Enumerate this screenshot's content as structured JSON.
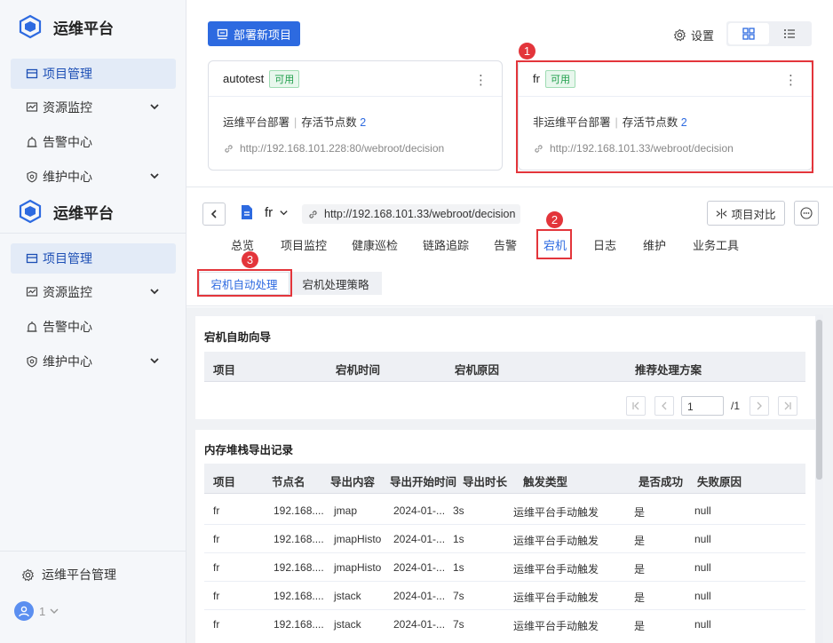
{
  "app": {
    "name": "运维平台"
  },
  "sidebar": {
    "items": [
      {
        "label": "项目管理"
      },
      {
        "label": "资源监控"
      },
      {
        "label": "告警中心"
      },
      {
        "label": "维护中心"
      }
    ],
    "bottom": {
      "label": "运维平台管理",
      "user": "1"
    }
  },
  "toolbar": {
    "deploy_label": "部署新项目",
    "settings_label": "设置"
  },
  "cards": [
    {
      "name": "autotest",
      "status": "可用",
      "type": "运维平台部署",
      "nodes_label": "存活节点数",
      "nodes": "2",
      "url": "http://192.168.101.228:80/webroot/decision"
    },
    {
      "name": "fr",
      "status": "可用",
      "type": "非运维平台部署",
      "nodes_label": "存活节点数",
      "nodes": "2",
      "url": "http://192.168.101.33/webroot/decision"
    }
  ],
  "markers": [
    "1",
    "2",
    "3"
  ],
  "detail": {
    "project": "fr",
    "url": "http://192.168.101.33/webroot/decision",
    "compare_label": "项目对比",
    "tabs": [
      "总览",
      "项目监控",
      "健康巡检",
      "链路追踪",
      "告警",
      "宕机",
      "日志",
      "维护",
      "业务工具"
    ],
    "subtabs": [
      "宕机自动处理",
      "宕机处理策略"
    ]
  },
  "guide": {
    "title": "宕机自助向导",
    "columns": [
      "项目",
      "宕机时间",
      "宕机原因",
      "推荐处理方案"
    ],
    "page": "1",
    "total_pages": "/1"
  },
  "dump": {
    "title": "内存堆栈导出记录",
    "columns": [
      "项目",
      "节点名",
      "导出内容",
      "导出开始时间",
      "导出时长",
      "触发类型",
      "是否成功",
      "失败原因"
    ],
    "rows": [
      [
        "fr",
        "192.168....",
        "jmap",
        "2024-01-...",
        "3s",
        "运维平台手动触发",
        "是",
        "null"
      ],
      [
        "fr",
        "192.168....",
        "jmapHisto",
        "2024-01-...",
        "1s",
        "运维平台手动触发",
        "是",
        "null"
      ],
      [
        "fr",
        "192.168....",
        "jmapHisto",
        "2024-01-...",
        "1s",
        "运维平台手动触发",
        "是",
        "null"
      ],
      [
        "fr",
        "192.168....",
        "jstack",
        "2024-01-...",
        "7s",
        "运维平台手动触发",
        "是",
        "null"
      ],
      [
        "fr",
        "192.168....",
        "jstack",
        "2024-01-...",
        "7s",
        "运维平台手动触发",
        "是",
        "null"
      ]
    ]
  }
}
